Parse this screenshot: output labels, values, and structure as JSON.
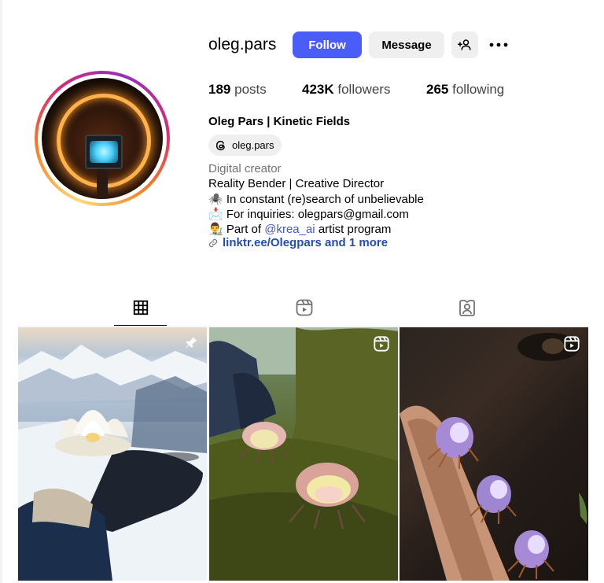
{
  "profile": {
    "username": "oleg.pars",
    "full_name": "Oleg Pars | Kinetic Fields",
    "threads_handle": "oleg.pars"
  },
  "actions": {
    "follow_label": "Follow",
    "message_label": "Message"
  },
  "stats": {
    "posts_count": "189",
    "posts_label": "posts",
    "followers_count": "423K",
    "followers_label": "followers",
    "following_count": "265",
    "following_label": "following"
  },
  "bio": {
    "category": "Digital creator",
    "line1": "Reality Bender | Creative Director",
    "line2_emoji": "🕷️",
    "line2": "In constant (re)search of unbelievable",
    "line3_emoji": "📩",
    "line3": "For inquiries: olegpars@gmail.com",
    "line4_emoji": "👨‍🎨",
    "line4_prefix": "Part of",
    "line4_mention": "@krea_ai",
    "line4_suffix": "artist program",
    "link_text": "linktr.ee/Olegpars and 1 more"
  },
  "tabs": [
    {
      "icon": "grid-icon",
      "active": true
    },
    {
      "icon": "reels-icon",
      "active": false
    },
    {
      "icon": "tagged-icon",
      "active": false
    }
  ],
  "posts": [
    {
      "badge_icon": "pin-icon",
      "subject": "white lotus flower on gloved hand, snowy mountains"
    },
    {
      "badge_icon": "reels-icon",
      "subject": "pink flower bud creatures on mossy tree"
    },
    {
      "badge_icon": "reels-icon",
      "subject": "purple bulb creatures crawling on branch"
    }
  ],
  "colors": {
    "follow_button": "#4a5df9",
    "secondary_button": "#efefef",
    "mention": "#4158d0",
    "link": "#234db0",
    "category_text": "#737373"
  }
}
